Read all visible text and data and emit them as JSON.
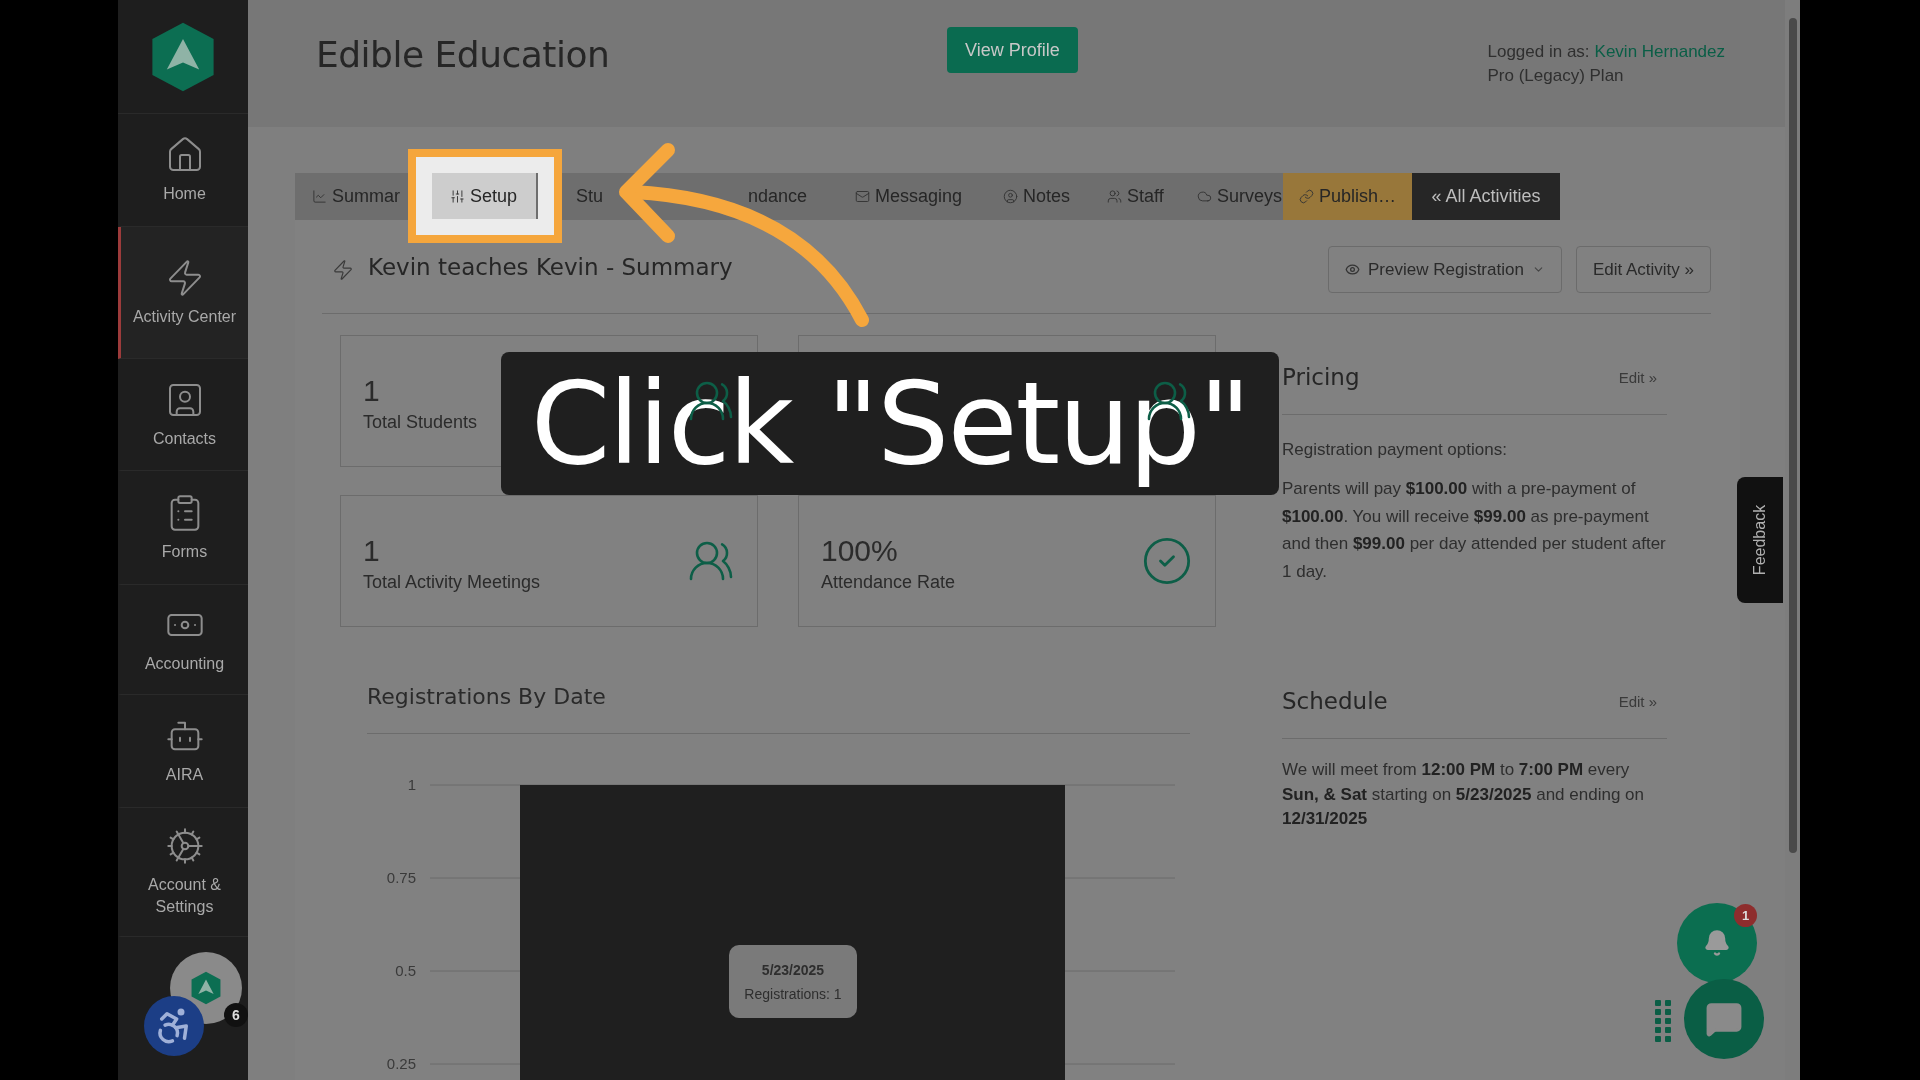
{
  "header": {
    "title": "Edible Education",
    "profile_button": "View Profile",
    "login_prefix": "Logged in as:",
    "login_user": "Kevin Hernandez",
    "plan": "Pro (Legacy) Plan"
  },
  "sidebar": {
    "items": [
      {
        "label": "Home",
        "selected": false
      },
      {
        "label": "Activity Center",
        "selected": true
      },
      {
        "label": "Contacts",
        "selected": false
      },
      {
        "label": "Forms",
        "selected": false
      },
      {
        "label": "Accounting",
        "selected": false
      },
      {
        "label": "AIRA",
        "selected": false
      },
      {
        "label": "Account & Settings",
        "selected": false
      }
    ],
    "avatar_badge": "6"
  },
  "tabs": [
    {
      "label": "Summar",
      "kind": "tab",
      "selected": false
    },
    {
      "label": "Setup",
      "kind": "tab",
      "selected": true
    },
    {
      "label": "Stu",
      "kind": "tab",
      "selected": false
    },
    {
      "label": "ndance",
      "kind": "tab",
      "selected": false
    },
    {
      "label": "Messaging",
      "kind": "tab",
      "selected": false
    },
    {
      "label": "Notes",
      "kind": "tab",
      "selected": false
    },
    {
      "label": "Staff",
      "kind": "tab",
      "selected": false
    },
    {
      "label": "Surveys",
      "kind": "tab",
      "selected": false
    },
    {
      "label": "Publish…",
      "kind": "publish",
      "selected": false
    },
    {
      "label": "« All Activities",
      "kind": "back",
      "selected": false
    }
  ],
  "activity": {
    "title": "Kevin teaches Kevin - Summary",
    "preview_button": "Preview Registration",
    "edit_button": "Edit Activity »"
  },
  "stats": [
    {
      "kind": "people",
      "value": "1",
      "label": "Total Students"
    },
    {
      "kind": "people"
    },
    {
      "kind": "people",
      "value": "1",
      "label": "Total Activity Meetings"
    },
    {
      "kind": "check",
      "value": "100%",
      "label": "Attendance Rate"
    }
  ],
  "registrations": {
    "title": "Registrations By Date",
    "tooltip_title": "5/23/2025",
    "tooltip_text": "Registrations: 1",
    "chart_data": {
      "type": "bar",
      "series": [
        {
          "color": "#1f1f1f",
          "values": [
            1
          ]
        }
      ],
      "ylim": [
        0.2,
        1
      ],
      "grid": true,
      "yticks": [
        0.25,
        0.5,
        0.75,
        1
      ]
    }
  },
  "pricing": {
    "title": "Pricing",
    "edit": "Edit »",
    "intro": "Registration payment options:",
    "text": "Parents will pay **$100.00** with a pre-payment of **$100.00**. You will receive **$99.00** as pre-payment and then **$99.00** per day attended per student after 1 day."
  },
  "schedule": {
    "title": "Schedule",
    "edit": "Edit »",
    "text": "We will meet from **12:00 PM** to **7:00 PM** every **Sun, & Sat** starting on **5/23/2025** and ending on **12/31/2025**"
  },
  "feedback": "Feedback",
  "notifications": {
    "badge": "1"
  },
  "callout": "Click \"Setup\""
}
